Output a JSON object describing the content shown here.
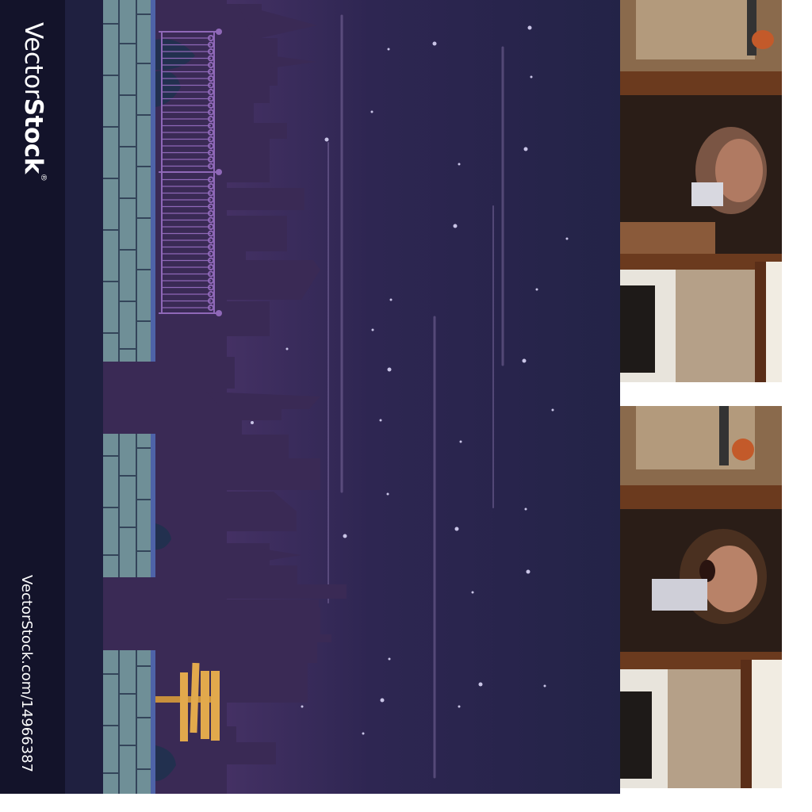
{
  "watermark": {
    "brand_light": "Vector",
    "brand_bold": "Stock",
    "brand_mark": "®",
    "url": "VectorStock.com/14966387"
  },
  "colors": {
    "sky_top": "#232347",
    "sky_bottom": "#5d3d78",
    "building": "#3a2a55",
    "wall_block": "#6f8f97",
    "railing": "#8f68b8",
    "sign": "#e2a94c",
    "watermark_bar": "#13132a"
  },
  "scene": {
    "name": "night-city-game-background"
  },
  "photos": [
    {
      "name": "photo-frame-top"
    },
    {
      "name": "photo-frame-bottom"
    }
  ]
}
